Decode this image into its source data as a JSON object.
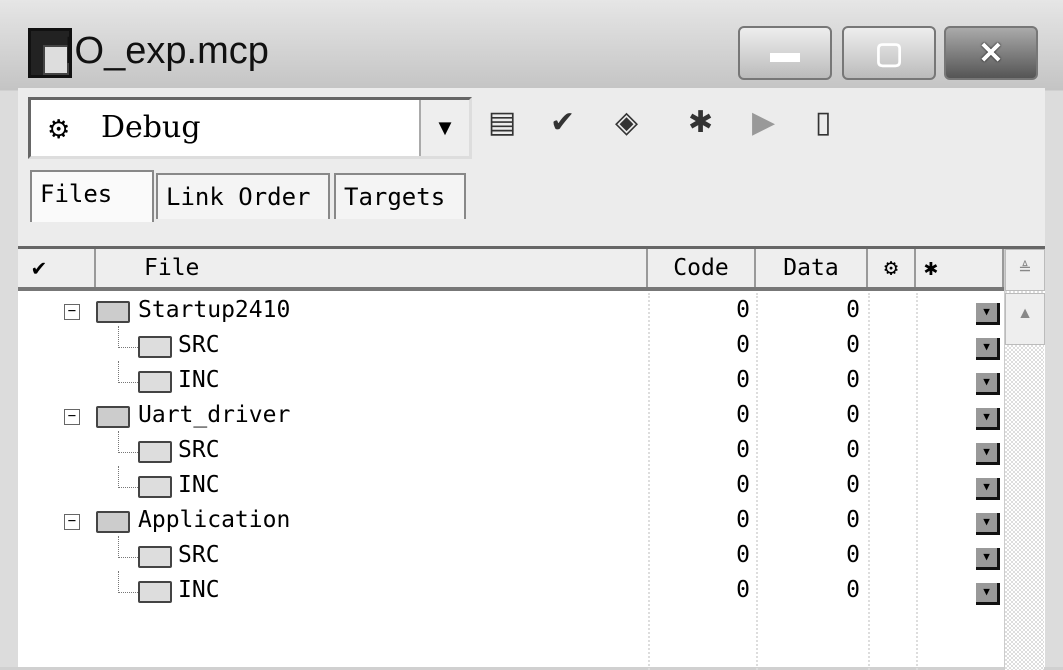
{
  "window": {
    "title": "IO_exp.mcp"
  },
  "toolbar": {
    "target": "Debug"
  },
  "tabs": [
    {
      "label": "Files"
    },
    {
      "label": "Link Order"
    },
    {
      "label": "Targets"
    }
  ],
  "table": {
    "headers": {
      "file": "File",
      "code": "Code",
      "data": "Data"
    },
    "rows": [
      {
        "name": "Startup2410",
        "type": "group",
        "code": "0",
        "data": "0"
      },
      {
        "name": "SRC",
        "type": "folder",
        "code": "0",
        "data": "0"
      },
      {
        "name": "INC",
        "type": "folder",
        "code": "0",
        "data": "0"
      },
      {
        "name": "Uart_driver",
        "type": "group",
        "code": "0",
        "data": "0"
      },
      {
        "name": "SRC",
        "type": "folder",
        "code": "0",
        "data": "0"
      },
      {
        "name": "INC",
        "type": "folder",
        "code": "0",
        "data": "0"
      },
      {
        "name": "Application",
        "type": "group",
        "code": "0",
        "data": "0"
      },
      {
        "name": "SRC",
        "type": "folder",
        "code": "0",
        "data": "0"
      },
      {
        "name": "INC",
        "type": "folder",
        "code": "0",
        "data": "0"
      }
    ]
  }
}
